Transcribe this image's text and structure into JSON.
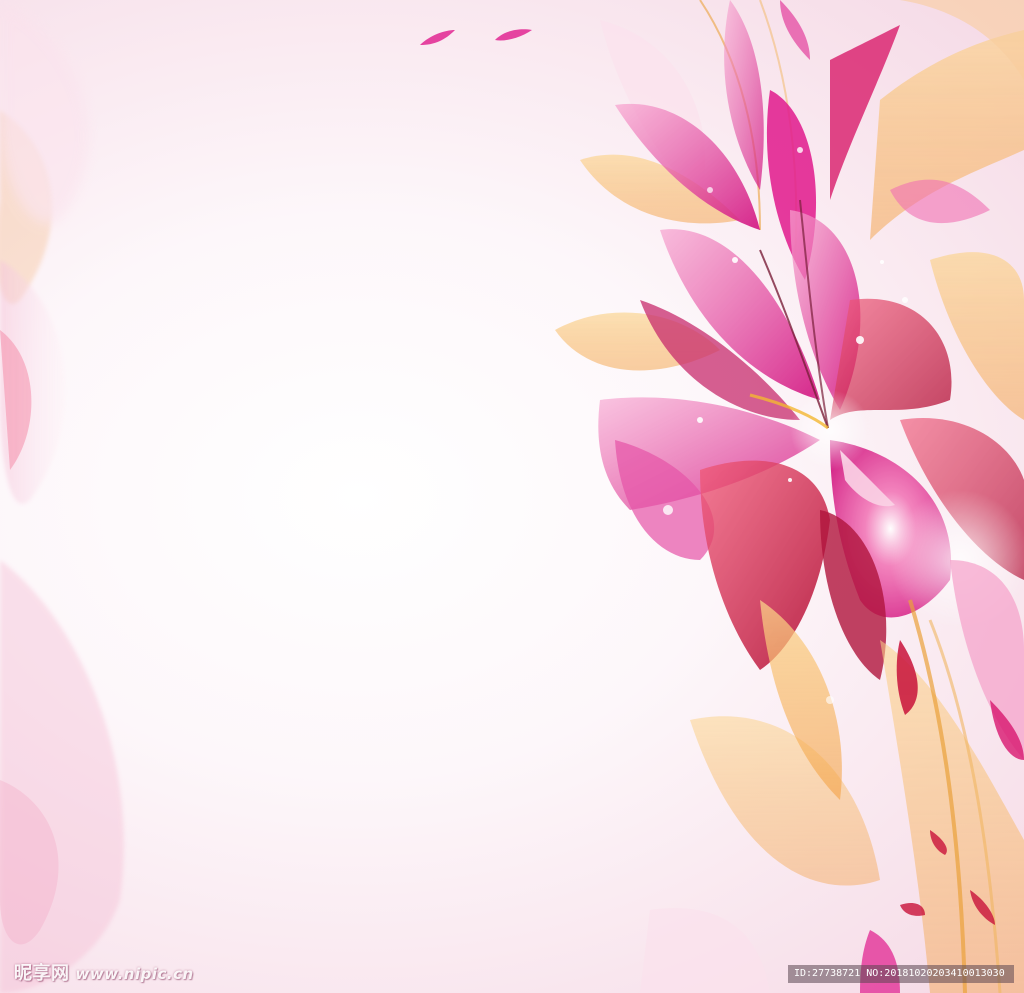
{
  "watermark": {
    "site_name": "昵享网",
    "site_url": "www.nipic.cn"
  },
  "id_bar": {
    "text": "ID:27738721 NO:20181020203410013030"
  },
  "colors": {
    "magenta": "#e0198c",
    "pink": "#f06fb2",
    "crimson": "#c8123a",
    "orange": "#f5a623",
    "light_pink": "#f8dbe8",
    "background": "#ffffff"
  }
}
